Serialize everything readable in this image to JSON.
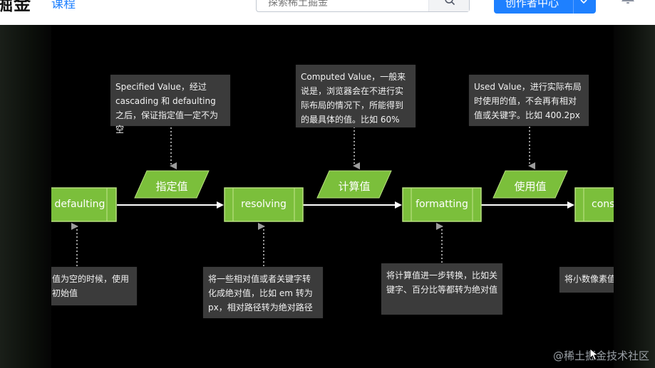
{
  "topbar": {
    "logo": "掘金",
    "nav_course": "课程",
    "search_placeholder": "探索稀土掘金",
    "creator_button": "创作者中心"
  },
  "diagram": {
    "nodes": {
      "defaulting": "defaulting",
      "resolving": "resolving",
      "formatting": "formatting",
      "constraining": "cons"
    },
    "values": {
      "specified": "指定值",
      "computed": "计算值",
      "used": "使用值"
    },
    "notes_top": {
      "specified": "Specified Value，经过 cascading 和 defaulting 之后，保证指定值一定不为空",
      "computed": "Computed Value，一般来说是，浏览器会在不进行实际布局的情况下，所能得到的最具体的值。比如 60%",
      "used": "Used Value，进行实际布局时使用的值，不会再有相对值或关键字。比如 400.2px"
    },
    "notes_bottom": {
      "defaulting": "值为空的时候，使用初始值",
      "resolving": "将一些相对值或者关键字转化成绝对值，比如 em 转为 px，相对路径转为绝对路径",
      "formatting": "将计算值进一步转换，比如关键字、百分比等都转为绝对值",
      "constraining": "将小数像素值"
    }
  },
  "watermark": "@稀土掘金技术社区",
  "colors": {
    "node_green": "#7bbf3b",
    "node_border": "#b8e07f",
    "note_bg": "#3b3b3b",
    "brand_blue": "#1e80ff"
  }
}
